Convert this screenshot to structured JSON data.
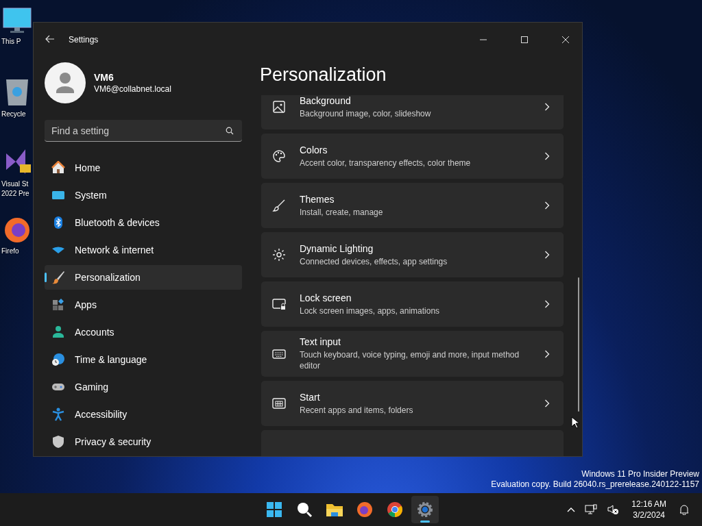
{
  "desktop_icons": [
    {
      "kind": "monitor",
      "label": "This P"
    },
    {
      "kind": "recycle",
      "label": "Recycle"
    },
    {
      "kind": "studio",
      "label": "Visual St\n2022 Pre"
    },
    {
      "kind": "firefox",
      "label": "Firefo"
    }
  ],
  "window": {
    "title": "Settings"
  },
  "user": {
    "name": "VM6",
    "email": "VM6@collabnet.local"
  },
  "search": {
    "placeholder": "Find a setting"
  },
  "nav_items": [
    {
      "kind": "home",
      "label": "Home",
      "selected": false
    },
    {
      "kind": "system",
      "label": "System",
      "selected": false
    },
    {
      "kind": "bluetooth",
      "label": "Bluetooth & devices",
      "selected": false
    },
    {
      "kind": "wifi",
      "label": "Network & internet",
      "selected": false
    },
    {
      "kind": "brush",
      "label": "Personalization",
      "selected": true
    },
    {
      "kind": "apps",
      "label": "Apps",
      "selected": false
    },
    {
      "kind": "person",
      "label": "Accounts",
      "selected": false
    },
    {
      "kind": "globe",
      "label": "Time & language",
      "selected": false
    },
    {
      "kind": "gamepad",
      "label": "Gaming",
      "selected": false
    },
    {
      "kind": "access",
      "label": "Accessibility",
      "selected": false
    },
    {
      "kind": "shield",
      "label": "Privacy & security",
      "selected": false
    }
  ],
  "page_title": "Personalization",
  "settings": [
    {
      "kind": "image",
      "title": "Background",
      "description": "Background image, color, slideshow"
    },
    {
      "kind": "palette",
      "title": "Colors",
      "description": "Accent color, transparency effects, color theme"
    },
    {
      "kind": "brush",
      "title": "Themes",
      "description": "Install, create, manage"
    },
    {
      "kind": "light",
      "title": "Dynamic Lighting",
      "description": "Connected devices, effects, app settings"
    },
    {
      "kind": "lock",
      "title": "Lock screen",
      "description": "Lock screen images, apps, animations"
    },
    {
      "kind": "keyboard",
      "title": "Text input",
      "description": "Touch keyboard, voice typing, emoji and more, input method editor"
    },
    {
      "kind": "start",
      "title": "Start",
      "description": "Recent apps and items, folders"
    }
  ],
  "watermark": [
    "Windows 11 Pro Insider Preview",
    "Evaluation copy. Build 26040.rs_prerelease.240122-1157"
  ],
  "taskbar_apps": [
    {
      "kind": "start",
      "selected": false
    },
    {
      "kind": "search",
      "selected": false
    },
    {
      "kind": "folder",
      "selected": false
    },
    {
      "kind": "firefox",
      "selected": false
    },
    {
      "kind": "chrome",
      "selected": false
    },
    {
      "kind": "settings",
      "selected": true
    }
  ],
  "clock": {
    "time": "12:16 AM",
    "date": "3/2/2024"
  }
}
